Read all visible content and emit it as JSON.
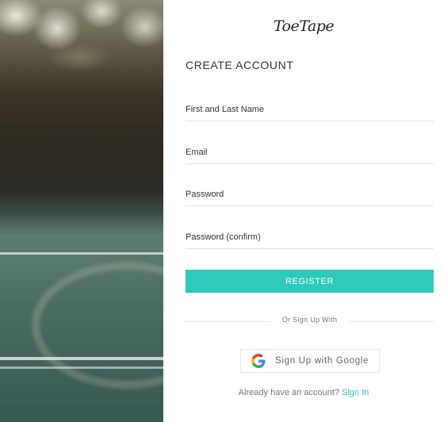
{
  "brand": {
    "logo_text": "ToeTape"
  },
  "form": {
    "title": "CREATE ACCOUNT",
    "fields": [
      {
        "placeholder": "First and Last Name",
        "value": ""
      },
      {
        "placeholder": "Email",
        "value": ""
      },
      {
        "placeholder": "Password",
        "value": ""
      },
      {
        "placeholder": "Password (confirm)",
        "value": ""
      }
    ],
    "register_label": "REGISTER",
    "divider_text": "Or Sign Up With",
    "google_label": "Sign Up with Google",
    "signin_prompt": "Already have an account?",
    "signin_link": "Sign In"
  },
  "colors": {
    "accent": "#2ec9b8",
    "google_blue": "#4285f4",
    "google_red": "#ea4335",
    "google_yellow": "#fbbc05",
    "google_green": "#34a853"
  },
  "icons": {
    "google": "google-g-icon"
  }
}
